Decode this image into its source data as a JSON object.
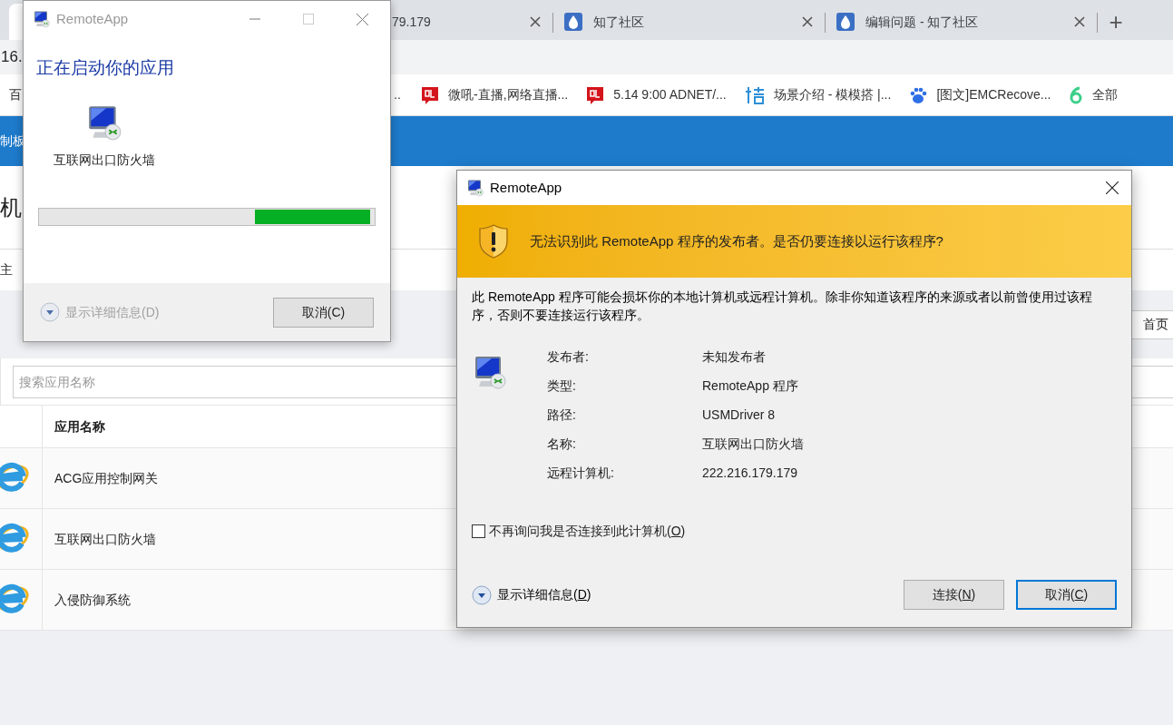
{
  "browser": {
    "tabs": [
      {
        "selected": true
      },
      {
        "label": "79.179",
        "selected": false,
        "icon": false
      },
      {
        "label": "知了社区",
        "selected": false,
        "icon": true
      },
      {
        "label": "编辑问题 - 知了社区",
        "selected": false,
        "icon": true
      }
    ],
    "new_tab": "+",
    "address_bar": {
      "value": "16."
    },
    "bookmarks": [
      {
        "label": "百"
      },
      {
        "label": ".."
      },
      {
        "label": "微吼-直播,网络直播...",
        "kind": "bubble"
      },
      {
        "label": "5.14 9:00 ADNET/...",
        "kind": "bubble"
      },
      {
        "label": "场景介绍 - 模模搭 |...",
        "kind": "scaffold"
      },
      {
        "label": "[图文]EMCRecove...",
        "kind": "paw"
      },
      {
        "label": "全部",
        "kind": "swirl"
      }
    ],
    "page": {
      "header": "制板",
      "heading": "机",
      "subnav": "主",
      "home_button": "首页",
      "search": {
        "placeholder": "搜索应用名称"
      },
      "table": {
        "columns": [
          "应用名称"
        ],
        "rows": [
          {
            "name": "ACG应用控制网关"
          },
          {
            "name": "互联网出口防火墙"
          },
          {
            "name": "入侵防御系统"
          }
        ]
      }
    }
  },
  "launch_dialog": {
    "title": "RemoteApp",
    "active": false,
    "heading": "正在启动你的应用",
    "app_name": "互联网出口防火墙",
    "details_toggle": {
      "before": "显示详细信息(",
      "key": "D",
      "after": ")",
      "disabled": true
    },
    "buttons": [
      {
        "before": "取消(",
        "key": "C",
        "after": ")",
        "focused": false,
        "underline": false
      }
    ]
  },
  "warning_dialog": {
    "title": "RemoteApp",
    "active": true,
    "banner": "无法识别此 RemoteApp 程序的发布者。是否仍要连接以运行该程序?",
    "message": "此 RemoteApp 程序可能会损坏你的本地计算机或远程计算机。除非你知道该程序的来源或者以前曾使用过该程序，否则不要连接运行该程序。",
    "details": [
      {
        "label": "发布者:",
        "value": "未知发布者"
      },
      {
        "label": "类型:",
        "value": "RemoteApp 程序"
      },
      {
        "label": "路径:",
        "value": "USMDriver 8"
      },
      {
        "label": "名称:",
        "value": "互联网出口防火墙"
      },
      {
        "label": "远程计算机:",
        "value": "222.216.179.179"
      }
    ],
    "dont_ask": {
      "before": "不再询问我是否连接到此计算机(",
      "key": "O",
      "after": ")",
      "checked": false
    },
    "details_toggle": {
      "before": "显示详细信息(",
      "key": "D",
      "after": ")",
      "disabled": false
    },
    "buttons": [
      {
        "before": "连接(",
        "key": "N",
        "after": ")",
        "focused": false,
        "underline": true
      },
      {
        "before": "取消(",
        "key": "C",
        "after": ")",
        "focused": true,
        "underline": true
      }
    ]
  }
}
